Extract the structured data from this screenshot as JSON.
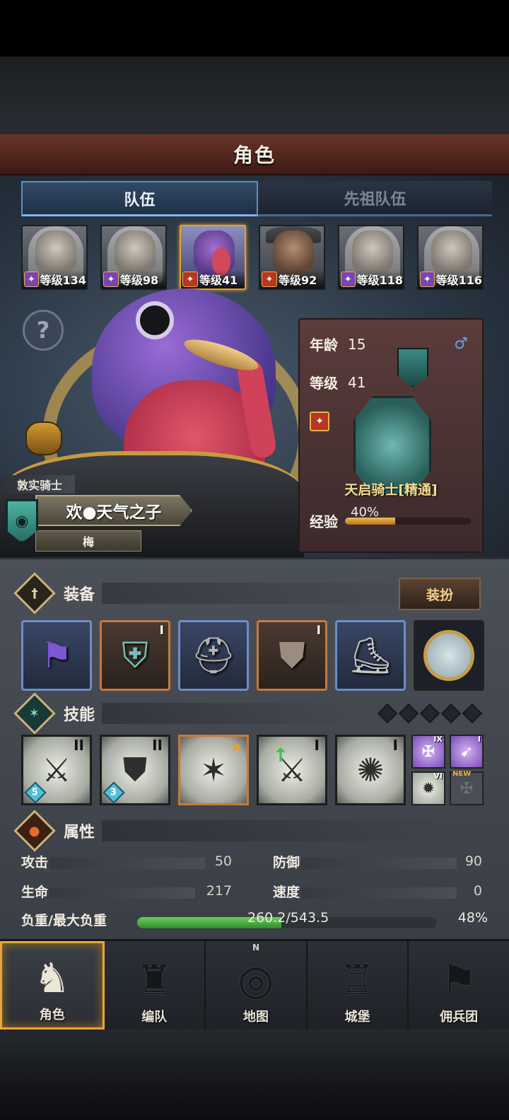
{
  "header": {
    "title": "角色"
  },
  "tabs": [
    {
      "label": "队伍",
      "active": true
    },
    {
      "label": "先祖队伍",
      "active": false
    }
  ],
  "party": [
    {
      "level_text": "等级134",
      "class_color": "purple",
      "selected": false
    },
    {
      "level_text": "等级98",
      "class_color": "purple",
      "selected": false
    },
    {
      "level_text": "等级41",
      "class_color": "red",
      "selected": true
    },
    {
      "level_text": "等级92",
      "class_color": "red",
      "selected": false
    },
    {
      "level_text": "等级118",
      "class_color": "purple",
      "selected": false
    },
    {
      "level_text": "等级116",
      "class_color": "purple",
      "selected": false
    }
  ],
  "help_glyph": "?",
  "character": {
    "title": "敦实骑士",
    "name": "欢●天气之子",
    "subname": "梅",
    "age_label": "年龄",
    "age": "15",
    "level_label": "等级",
    "level": "41",
    "gender_glyph": "♂",
    "class_name": "天启骑士[精通]",
    "exp_label": "经验",
    "exp_pct_text": "40%",
    "exp_fraction": 0.4
  },
  "equipment": {
    "title": "装备",
    "dress_button": "装扮",
    "slots": [
      {
        "icon": "banner-icon",
        "glyph": "⚑",
        "roman": "",
        "tier": "blue"
      },
      {
        "icon": "shield-icon",
        "glyph": "⛨",
        "roman": "I",
        "tier": "orange"
      },
      {
        "icon": "helmet-icon",
        "glyph": "⛑",
        "roman": "",
        "tier": "blue"
      },
      {
        "icon": "armor-icon",
        "glyph": "⛊",
        "roman": "I",
        "tier": "orange"
      },
      {
        "icon": "boots-icon",
        "glyph": "⛸",
        "roman": "",
        "tier": "blue"
      },
      {
        "icon": "trinket-icon",
        "glyph": "",
        "roman": "",
        "tier": "coin"
      }
    ]
  },
  "skills": {
    "title": "技能",
    "main": [
      {
        "icon": "spear-stance-icon",
        "glyph": "⚔",
        "roman": "II",
        "count": "5"
      },
      {
        "icon": "guard-stance-icon",
        "glyph": "⛊",
        "roman": "II",
        "count": "3"
      },
      {
        "icon": "shatter-star-icon",
        "glyph": "✶",
        "roman": "",
        "count": ""
      },
      {
        "icon": "buff-strike-icon",
        "glyph": "⚔",
        "roman": "I",
        "count": ""
      },
      {
        "icon": "burst-strike-icon",
        "glyph": "✺",
        "roman": "I",
        "count": ""
      }
    ],
    "mini": [
      {
        "icon": "holy-cross-icon",
        "glyph": "✠",
        "roman": "IX",
        "style": "purple",
        "new": ""
      },
      {
        "icon": "lance-icon",
        "glyph": "➹",
        "roman": "I",
        "style": "purple",
        "new": ""
      },
      {
        "icon": "burst-icon",
        "glyph": "✹",
        "roman": "VI",
        "style": "white",
        "new": ""
      },
      {
        "icon": "empty-slot-icon",
        "glyph": "✠",
        "roman": "",
        "style": "empty",
        "new": "NEW"
      }
    ]
  },
  "attributes": {
    "title": "属性",
    "attack_label": "攻击",
    "attack": "50",
    "defense_label": "防御",
    "defense": "90",
    "hp_label": "生命",
    "hp": "217",
    "speed_label": "速度",
    "speed": "0",
    "load_label": "负重/最大负重",
    "load_text": "260.2/543.5",
    "load_pct": "48%",
    "load_fraction": 0.48
  },
  "nav": [
    {
      "label": "角色",
      "icon": "knight-icon",
      "glyph": "♞",
      "active": true
    },
    {
      "label": "编队",
      "icon": "formation-icon",
      "glyph": "♜",
      "active": false
    },
    {
      "label": "地图",
      "icon": "compass-map-icon",
      "glyph": "◎",
      "active": false,
      "n": "N"
    },
    {
      "label": "城堡",
      "icon": "castle-icon",
      "glyph": "♖",
      "active": false
    },
    {
      "label": "佣兵团",
      "icon": "mercenary-icon",
      "glyph": "⚑",
      "active": false
    }
  ]
}
